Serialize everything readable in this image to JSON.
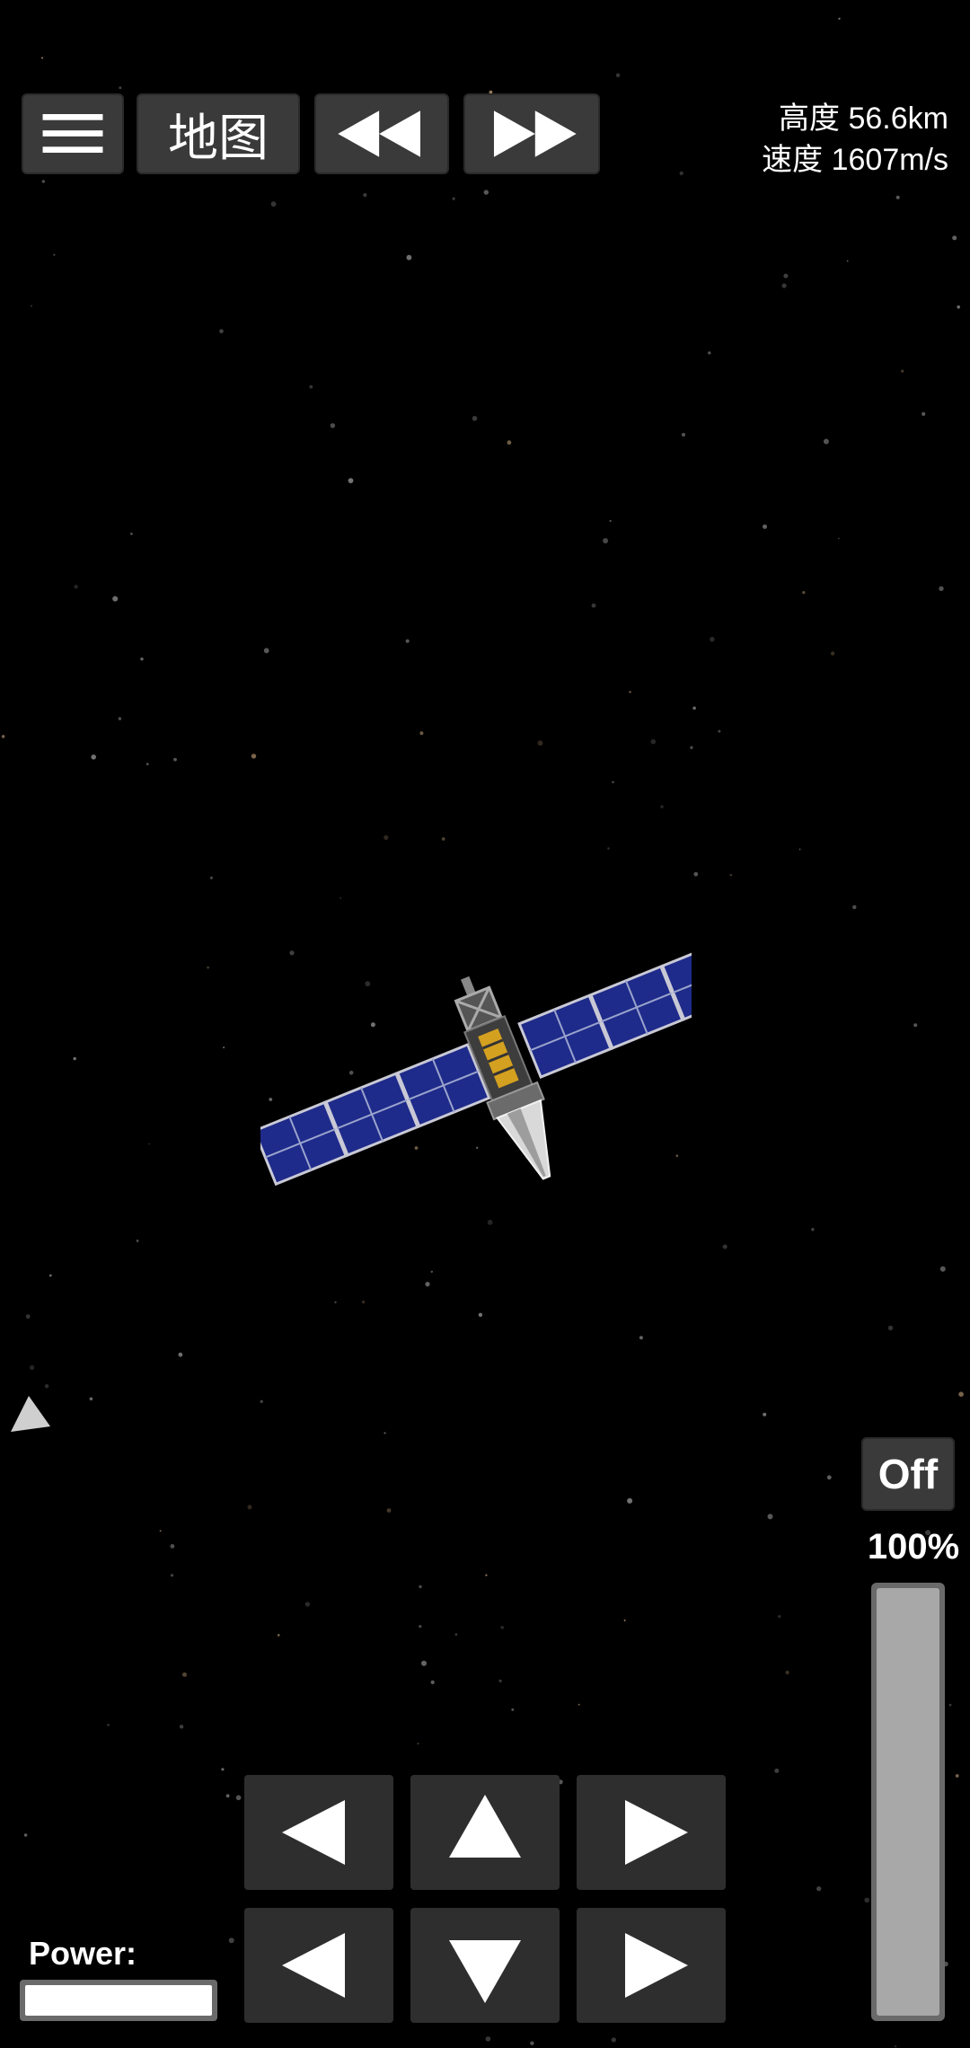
{
  "hud": {
    "map_label": "地图",
    "altitude": "高度 56.6km",
    "speed": "速度 1607m/s"
  },
  "throttle": {
    "state_label": "Off",
    "percent_label": "100%",
    "level": 1.0
  },
  "power": {
    "label": "Power:",
    "level": 1.0
  },
  "icons": {
    "menu": "hamburger-icon",
    "rewind": "rewind-icon",
    "fast_forward": "fast-forward-icon",
    "direction": "direction-indicator-icon",
    "controls": [
      "rotate-left-icon",
      "thrust-up-icon",
      "rotate-right-icon",
      "slide-left-icon",
      "thrust-down-icon",
      "slide-right-icon"
    ]
  },
  "colors": {
    "background": "#000000",
    "button": "#3a3a3a",
    "solar_panel": "#1e2b8a",
    "throttle_fill": "#a8a8a8"
  }
}
